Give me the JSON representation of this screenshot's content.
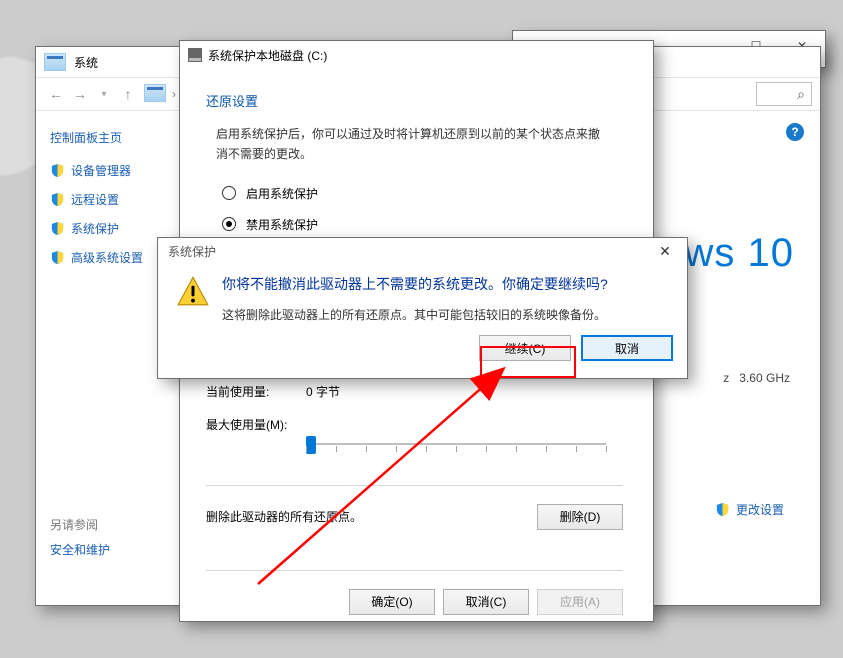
{
  "outerWindow": {
    "minimize": "—",
    "maximize": "☐",
    "close": "✕"
  },
  "systemWindow": {
    "title": "系统",
    "toolbar": {
      "back": "←",
      "forward": "→",
      "up": "↑",
      "search_icon": "⌕"
    },
    "sidebar": {
      "home": "控制面板主页",
      "items": [
        "设备管理器",
        "远程设置",
        "系统保护",
        "高级系统设置"
      ],
      "also_title": "另请参阅",
      "also_link": "安全和维护"
    },
    "os_brand_suffix": "ws 10",
    "spec": {
      "hz": "z",
      "ghz": "3.60 GHz"
    },
    "change_link": "更改设置",
    "help": "?"
  },
  "protectionDialog": {
    "title": "系统保护本地磁盘 (C:)",
    "restore_section": "还原设置",
    "restore_desc": "启用系统保护后，你可以通过及时将计算机还原到以前的某个状态点来撤消不需要的更改。",
    "radio_enable": "启用系统保护",
    "radio_disable": "禁用系统保护",
    "usage": {
      "current_label": "当前使用量:",
      "current_value": "0 字节",
      "max_label": "最大使用量(M):"
    },
    "delete_desc": "删除此驱动器的所有还原点。",
    "buttons": {
      "delete": "删除(D)",
      "ok": "确定(O)",
      "cancel": "取消(C)",
      "apply": "应用(A)"
    }
  },
  "confirmDialog": {
    "title": "系统保护",
    "heading": "你将不能撤消此驱动器上不需要的系统更改。你确定要继续吗?",
    "text": "这将删除此驱动器上的所有还原点。其中可能包括较旧的系统映像备份。",
    "buttons": {
      "continue": "继续(C)",
      "cancel": "取消"
    },
    "close": "✕"
  }
}
